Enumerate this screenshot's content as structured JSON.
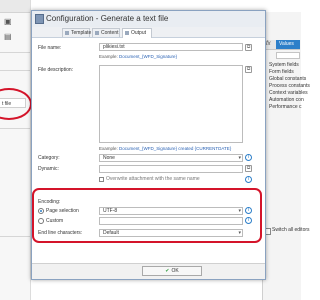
{
  "background": {
    "left_selected_label": "t file",
    "right_panel": {
      "tab_label": "Values",
      "items": [
        {
          "label": "System fields"
        },
        {
          "label": "Form fields"
        },
        {
          "label": "Global constants"
        },
        {
          "label": "Process constants"
        },
        {
          "label": "Context variables"
        },
        {
          "label": "Automation con"
        },
        {
          "label": "Performance c"
        }
      ],
      "switch_all_editors": "Switch all editors"
    }
  },
  "dialog": {
    "title": "Configuration - Generate a text file",
    "tabs": [
      {
        "label": "Template",
        "active": false
      },
      {
        "label": "Content",
        "active": false
      },
      {
        "label": "Output",
        "active": true
      }
    ],
    "fields": {
      "file_name": {
        "label": "File name:",
        "value": "plikiesi.txt"
      },
      "file_name_example_prefix": "Example:",
      "file_name_example": "Document_{WFD_Signature}",
      "file_description": {
        "label": "File description:",
        "value": ""
      },
      "file_description_example_prefix": "Example:",
      "file_description_example": "Document_{WFD_Signature} created {CURRENTDATE}",
      "category": {
        "label": "Category:",
        "value": "None"
      },
      "dynamic": {
        "label": "Dynamic:",
        "value": ""
      },
      "overwrite_label": "Overwrite attachment with the same name",
      "encoding_label": "Encoding:",
      "page_selection": {
        "label": "Page selection",
        "value": "UTF-8",
        "selected": true
      },
      "custom": {
        "label": "Custom",
        "value": "",
        "selected": false
      },
      "end_line": {
        "label": "End line characters:",
        "value": "Default"
      }
    },
    "ok_label": "OK"
  },
  "colors": {
    "accent": "#2d7fc9",
    "highlight": "#d4142a"
  }
}
